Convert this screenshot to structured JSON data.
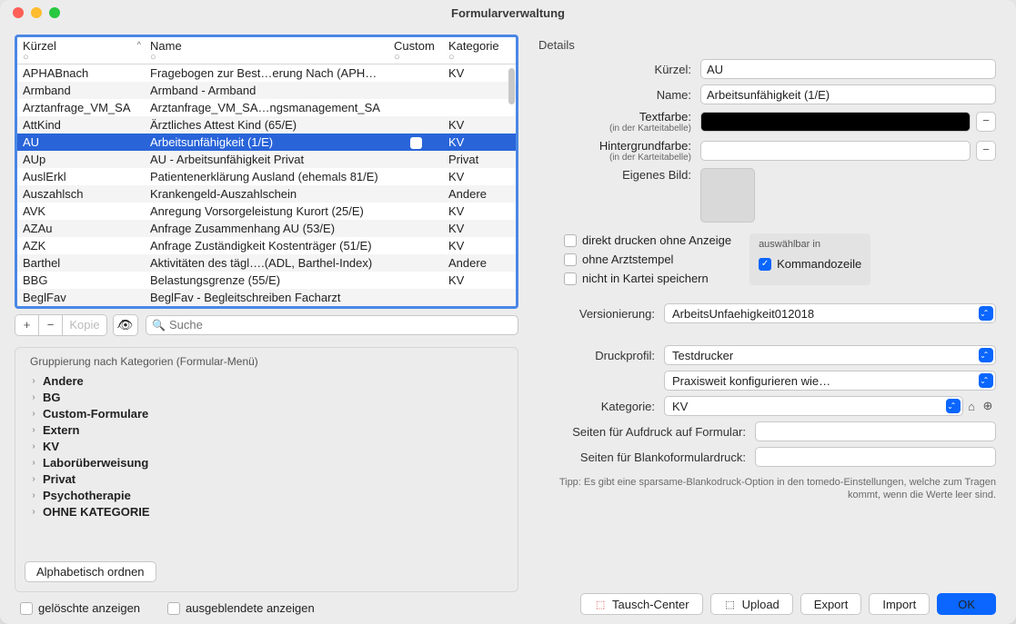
{
  "title": "Formularverwaltung",
  "table": {
    "headers": {
      "kurzel": "Kürzel",
      "name": "Name",
      "custom": "Custom",
      "kategorie": "Kategorie"
    },
    "rows": [
      {
        "k": "APHABnach",
        "n": "Fragebogen zur Best…erung Nach (APHAB)",
        "kat": "KV",
        "sel": false
      },
      {
        "k": "Armband",
        "n": "Armband - Armband",
        "kat": "",
        "sel": false
      },
      {
        "k": "Arztanfrage_VM_SA",
        "n": "Arztanfrage_VM_SA…ngsmanagement_SA",
        "kat": "",
        "sel": false
      },
      {
        "k": "AttKind",
        "n": "Ärztliches Attest Kind (65/E)",
        "kat": "KV",
        "sel": false
      },
      {
        "k": "AU",
        "n": "Arbeitsunfähigkeit (1/E)",
        "kat": "KV",
        "sel": true
      },
      {
        "k": "AUp",
        "n": "AU - Arbeitsunfähigkeit Privat",
        "kat": "Privat",
        "sel": false
      },
      {
        "k": "AuslErkl",
        "n": "Patientenerklärung Ausland (ehemals 81/E)",
        "kat": "KV",
        "sel": false
      },
      {
        "k": "Auszahlsch",
        "n": "Krankengeld-Auszahlschein",
        "kat": "Andere",
        "sel": false
      },
      {
        "k": "AVK",
        "n": "Anregung Vorsorgeleistung Kurort (25/E)",
        "kat": "KV",
        "sel": false
      },
      {
        "k": "AZAu",
        "n": "Anfrage Zusammenhang AU (53/E)",
        "kat": "KV",
        "sel": false
      },
      {
        "k": "AZK",
        "n": "Anfrage Zuständigkeit Kostenträger (51/E)",
        "kat": "KV",
        "sel": false
      },
      {
        "k": "Barthel",
        "n": "Aktivitäten des tägl….(ADL, Barthel-Index)",
        "kat": "Andere",
        "sel": false
      },
      {
        "k": "BBG",
        "n": "Belastungsgrenze (55/E)",
        "kat": "KV",
        "sel": false
      },
      {
        "k": "BeglFav",
        "n": "BeglFav - Begleitschreiben Facharzt",
        "kat": "",
        "sel": false
      }
    ]
  },
  "toolbar": {
    "plus": "+",
    "minus": "−",
    "kopie": "Kopie",
    "search_placeholder": "Suche"
  },
  "grouping": {
    "title": "Gruppierung nach Kategorien (Formular-Menü)",
    "cats": [
      "Andere",
      "BG",
      "Custom-Formulare",
      "Extern",
      "KV",
      "Laborüberweisung",
      "Privat",
      "Psychotherapie",
      "OHNE KATEGORIE"
    ],
    "order": "Alphabetisch ordnen"
  },
  "bottom": {
    "deleted": "gelöschte anzeigen",
    "hidden": "ausgeblendete anzeigen"
  },
  "details": {
    "heading": "Details",
    "kurzel_l": "Kürzel:",
    "kurzel_v": "AU",
    "name_l": "Name:",
    "name_v": "Arbeitsunfähigkeit (1/E)",
    "textfarbe_l": "Textfarbe:",
    "sub": "(in der Karteitabelle)",
    "hintergrund_l": "Hintergrundfarbe:",
    "bild_l": "Eigenes Bild:",
    "checks": {
      "direkt": "direkt drucken ohne Anzeige",
      "stempel": "ohne Arztstempel",
      "kartei": "nicht in Kartei speichern"
    },
    "selgroup": {
      "title": "auswählbar in",
      "kz": "Kommandozeile"
    },
    "version_l": "Versionierung:",
    "version_v": "ArbeitsUnfaehigkeit012018",
    "druck_l": "Druckprofil:",
    "druck_v": "Testdrucker",
    "praxis": "Praxisweit konfigurieren wie…",
    "kat_l": "Kategorie:",
    "kat_v": "KV",
    "aufdruck_l": "Seiten für Aufdruck auf Formular:",
    "blanko_l": "Seiten für Blankoformulardruck:",
    "tip": "Tipp: Es gibt eine sparsame-Blankodruck-Option in den tomedo-Einstellungen, welche zum Tragen kommt, wenn die Werte leer sind."
  },
  "footer": {
    "tausch": "Tausch-Center",
    "upload": "Upload",
    "export": "Export",
    "import": "Import",
    "ok": "OK"
  }
}
